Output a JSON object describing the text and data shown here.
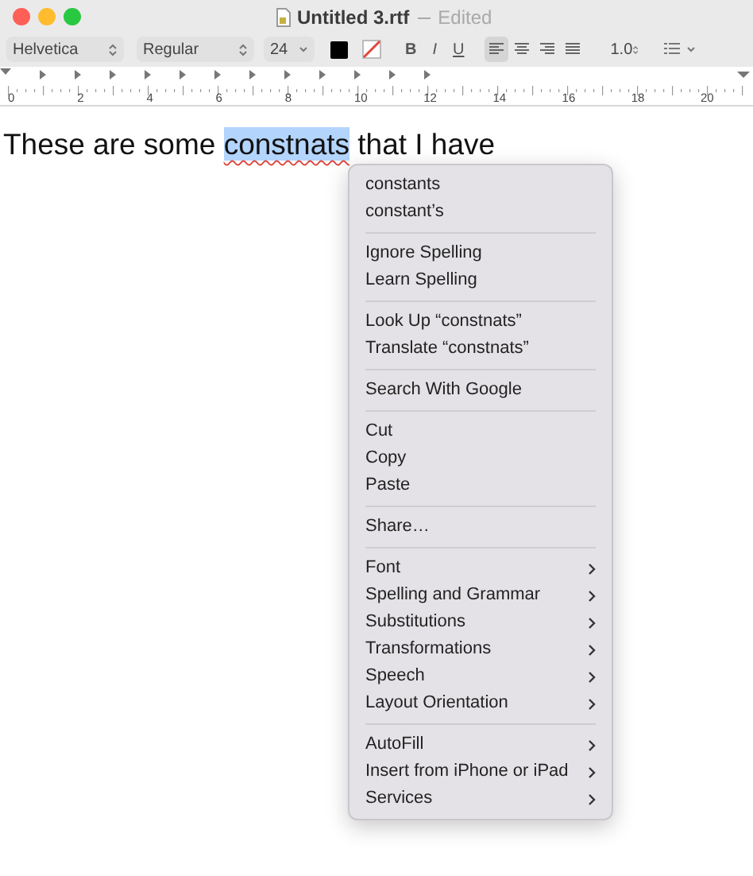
{
  "window": {
    "title": "Untitled 3.rtf",
    "status": "Edited"
  },
  "toolbar": {
    "font_family": "Helvetica",
    "font_style": "Regular",
    "font_size": "24",
    "bold": "B",
    "italic": "I",
    "underline": "U",
    "alignments": [
      {
        "kind": "left",
        "selected": true
      },
      {
        "kind": "center",
        "selected": false
      },
      {
        "kind": "right",
        "selected": false
      },
      {
        "kind": "justify",
        "selected": false
      }
    ],
    "line_spacing": "1.0"
  },
  "ruler": {
    "labels": [
      "0",
      "2",
      "4",
      "6",
      "8",
      "10",
      "12",
      "14",
      "16",
      "18",
      "20"
    ]
  },
  "document": {
    "text_before": "These are some ",
    "selected_text": "constnats",
    "misspelled": true,
    "text_after": " that I have"
  },
  "context_menu": {
    "sections": [
      {
        "items": [
          {
            "label": "constants",
            "submenu": false
          },
          {
            "label": "constant’s",
            "submenu": false
          }
        ]
      },
      {
        "items": [
          {
            "label": "Ignore Spelling",
            "submenu": false
          },
          {
            "label": "Learn Spelling",
            "submenu": false
          }
        ]
      },
      {
        "items": [
          {
            "label": "Look Up “constnats”",
            "submenu": false
          },
          {
            "label": "Translate “constnats”",
            "submenu": false
          }
        ]
      },
      {
        "items": [
          {
            "label": "Search With Google",
            "submenu": false
          }
        ]
      },
      {
        "items": [
          {
            "label": "Cut",
            "submenu": false
          },
          {
            "label": "Copy",
            "submenu": false
          },
          {
            "label": "Paste",
            "submenu": false
          }
        ]
      },
      {
        "items": [
          {
            "label": "Share…",
            "submenu": false
          }
        ]
      },
      {
        "items": [
          {
            "label": "Font",
            "submenu": true
          },
          {
            "label": "Spelling and Grammar",
            "submenu": true
          },
          {
            "label": "Substitutions",
            "submenu": true
          },
          {
            "label": "Transformations",
            "submenu": true
          },
          {
            "label": "Speech",
            "submenu": true
          },
          {
            "label": "Layout Orientation",
            "submenu": true
          }
        ]
      },
      {
        "items": [
          {
            "label": "AutoFill",
            "submenu": true
          },
          {
            "label": "Insert from iPhone or iPad",
            "submenu": true
          },
          {
            "label": "Services",
            "submenu": true
          }
        ]
      }
    ]
  }
}
